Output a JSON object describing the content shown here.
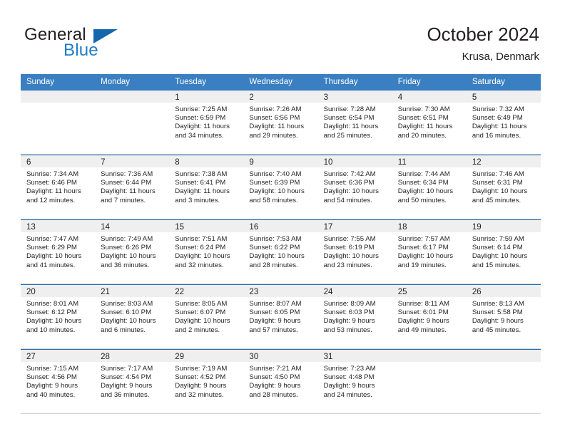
{
  "brand": {
    "name_top": "General",
    "name_bottom": "Blue",
    "flag_color": "#1566ab",
    "blue_color": "#1f7dc4"
  },
  "header": {
    "title": "October 2024",
    "location": "Krusa, Denmark"
  },
  "theme": {
    "header_row_bg": "#3a7fc1",
    "date_band_bg": "#efefef",
    "cell_top_border": "#1f6cb0",
    "cell_bottom_border": "#cfd3d6",
    "text": "#231f20"
  },
  "weekdays": [
    "Sunday",
    "Monday",
    "Tuesday",
    "Wednesday",
    "Thursday",
    "Friday",
    "Saturday"
  ],
  "weeks": [
    [
      {
        "day": "",
        "sunrise": "",
        "sunset": "",
        "daylight_line1": "",
        "daylight_line2": ""
      },
      {
        "day": "",
        "sunrise": "",
        "sunset": "",
        "daylight_line1": "",
        "daylight_line2": ""
      },
      {
        "day": "1",
        "sunrise": "Sunrise: 7:25 AM",
        "sunset": "Sunset: 6:59 PM",
        "daylight_line1": "Daylight: 11 hours",
        "daylight_line2": "and 34 minutes."
      },
      {
        "day": "2",
        "sunrise": "Sunrise: 7:26 AM",
        "sunset": "Sunset: 6:56 PM",
        "daylight_line1": "Daylight: 11 hours",
        "daylight_line2": "and 29 minutes."
      },
      {
        "day": "3",
        "sunrise": "Sunrise: 7:28 AM",
        "sunset": "Sunset: 6:54 PM",
        "daylight_line1": "Daylight: 11 hours",
        "daylight_line2": "and 25 minutes."
      },
      {
        "day": "4",
        "sunrise": "Sunrise: 7:30 AM",
        "sunset": "Sunset: 6:51 PM",
        "daylight_line1": "Daylight: 11 hours",
        "daylight_line2": "and 20 minutes."
      },
      {
        "day": "5",
        "sunrise": "Sunrise: 7:32 AM",
        "sunset": "Sunset: 6:49 PM",
        "daylight_line1": "Daylight: 11 hours",
        "daylight_line2": "and 16 minutes."
      }
    ],
    [
      {
        "day": "6",
        "sunrise": "Sunrise: 7:34 AM",
        "sunset": "Sunset: 6:46 PM",
        "daylight_line1": "Daylight: 11 hours",
        "daylight_line2": "and 12 minutes."
      },
      {
        "day": "7",
        "sunrise": "Sunrise: 7:36 AM",
        "sunset": "Sunset: 6:44 PM",
        "daylight_line1": "Daylight: 11 hours",
        "daylight_line2": "and 7 minutes."
      },
      {
        "day": "8",
        "sunrise": "Sunrise: 7:38 AM",
        "sunset": "Sunset: 6:41 PM",
        "daylight_line1": "Daylight: 11 hours",
        "daylight_line2": "and 3 minutes."
      },
      {
        "day": "9",
        "sunrise": "Sunrise: 7:40 AM",
        "sunset": "Sunset: 6:39 PM",
        "daylight_line1": "Daylight: 10 hours",
        "daylight_line2": "and 58 minutes."
      },
      {
        "day": "10",
        "sunrise": "Sunrise: 7:42 AM",
        "sunset": "Sunset: 6:36 PM",
        "daylight_line1": "Daylight: 10 hours",
        "daylight_line2": "and 54 minutes."
      },
      {
        "day": "11",
        "sunrise": "Sunrise: 7:44 AM",
        "sunset": "Sunset: 6:34 PM",
        "daylight_line1": "Daylight: 10 hours",
        "daylight_line2": "and 50 minutes."
      },
      {
        "day": "12",
        "sunrise": "Sunrise: 7:46 AM",
        "sunset": "Sunset: 6:31 PM",
        "daylight_line1": "Daylight: 10 hours",
        "daylight_line2": "and 45 minutes."
      }
    ],
    [
      {
        "day": "13",
        "sunrise": "Sunrise: 7:47 AM",
        "sunset": "Sunset: 6:29 PM",
        "daylight_line1": "Daylight: 10 hours",
        "daylight_line2": "and 41 minutes."
      },
      {
        "day": "14",
        "sunrise": "Sunrise: 7:49 AM",
        "sunset": "Sunset: 6:26 PM",
        "daylight_line1": "Daylight: 10 hours",
        "daylight_line2": "and 36 minutes."
      },
      {
        "day": "15",
        "sunrise": "Sunrise: 7:51 AM",
        "sunset": "Sunset: 6:24 PM",
        "daylight_line1": "Daylight: 10 hours",
        "daylight_line2": "and 32 minutes."
      },
      {
        "day": "16",
        "sunrise": "Sunrise: 7:53 AM",
        "sunset": "Sunset: 6:22 PM",
        "daylight_line1": "Daylight: 10 hours",
        "daylight_line2": "and 28 minutes."
      },
      {
        "day": "17",
        "sunrise": "Sunrise: 7:55 AM",
        "sunset": "Sunset: 6:19 PM",
        "daylight_line1": "Daylight: 10 hours",
        "daylight_line2": "and 23 minutes."
      },
      {
        "day": "18",
        "sunrise": "Sunrise: 7:57 AM",
        "sunset": "Sunset: 6:17 PM",
        "daylight_line1": "Daylight: 10 hours",
        "daylight_line2": "and 19 minutes."
      },
      {
        "day": "19",
        "sunrise": "Sunrise: 7:59 AM",
        "sunset": "Sunset: 6:14 PM",
        "daylight_line1": "Daylight: 10 hours",
        "daylight_line2": "and 15 minutes."
      }
    ],
    [
      {
        "day": "20",
        "sunrise": "Sunrise: 8:01 AM",
        "sunset": "Sunset: 6:12 PM",
        "daylight_line1": "Daylight: 10 hours",
        "daylight_line2": "and 10 minutes."
      },
      {
        "day": "21",
        "sunrise": "Sunrise: 8:03 AM",
        "sunset": "Sunset: 6:10 PM",
        "daylight_line1": "Daylight: 10 hours",
        "daylight_line2": "and 6 minutes."
      },
      {
        "day": "22",
        "sunrise": "Sunrise: 8:05 AM",
        "sunset": "Sunset: 6:07 PM",
        "daylight_line1": "Daylight: 10 hours",
        "daylight_line2": "and 2 minutes."
      },
      {
        "day": "23",
        "sunrise": "Sunrise: 8:07 AM",
        "sunset": "Sunset: 6:05 PM",
        "daylight_line1": "Daylight: 9 hours",
        "daylight_line2": "and 57 minutes."
      },
      {
        "day": "24",
        "sunrise": "Sunrise: 8:09 AM",
        "sunset": "Sunset: 6:03 PM",
        "daylight_line1": "Daylight: 9 hours",
        "daylight_line2": "and 53 minutes."
      },
      {
        "day": "25",
        "sunrise": "Sunrise: 8:11 AM",
        "sunset": "Sunset: 6:01 PM",
        "daylight_line1": "Daylight: 9 hours",
        "daylight_line2": "and 49 minutes."
      },
      {
        "day": "26",
        "sunrise": "Sunrise: 8:13 AM",
        "sunset": "Sunset: 5:58 PM",
        "daylight_line1": "Daylight: 9 hours",
        "daylight_line2": "and 45 minutes."
      }
    ],
    [
      {
        "day": "27",
        "sunrise": "Sunrise: 7:15 AM",
        "sunset": "Sunset: 4:56 PM",
        "daylight_line1": "Daylight: 9 hours",
        "daylight_line2": "and 40 minutes."
      },
      {
        "day": "28",
        "sunrise": "Sunrise: 7:17 AM",
        "sunset": "Sunset: 4:54 PM",
        "daylight_line1": "Daylight: 9 hours",
        "daylight_line2": "and 36 minutes."
      },
      {
        "day": "29",
        "sunrise": "Sunrise: 7:19 AM",
        "sunset": "Sunset: 4:52 PM",
        "daylight_line1": "Daylight: 9 hours",
        "daylight_line2": "and 32 minutes."
      },
      {
        "day": "30",
        "sunrise": "Sunrise: 7:21 AM",
        "sunset": "Sunset: 4:50 PM",
        "daylight_line1": "Daylight: 9 hours",
        "daylight_line2": "and 28 minutes."
      },
      {
        "day": "31",
        "sunrise": "Sunrise: 7:23 AM",
        "sunset": "Sunset: 4:48 PM",
        "daylight_line1": "Daylight: 9 hours",
        "daylight_line2": "and 24 minutes."
      },
      {
        "day": "",
        "sunrise": "",
        "sunset": "",
        "daylight_line1": "",
        "daylight_line2": ""
      },
      {
        "day": "",
        "sunrise": "",
        "sunset": "",
        "daylight_line1": "",
        "daylight_line2": ""
      }
    ]
  ]
}
